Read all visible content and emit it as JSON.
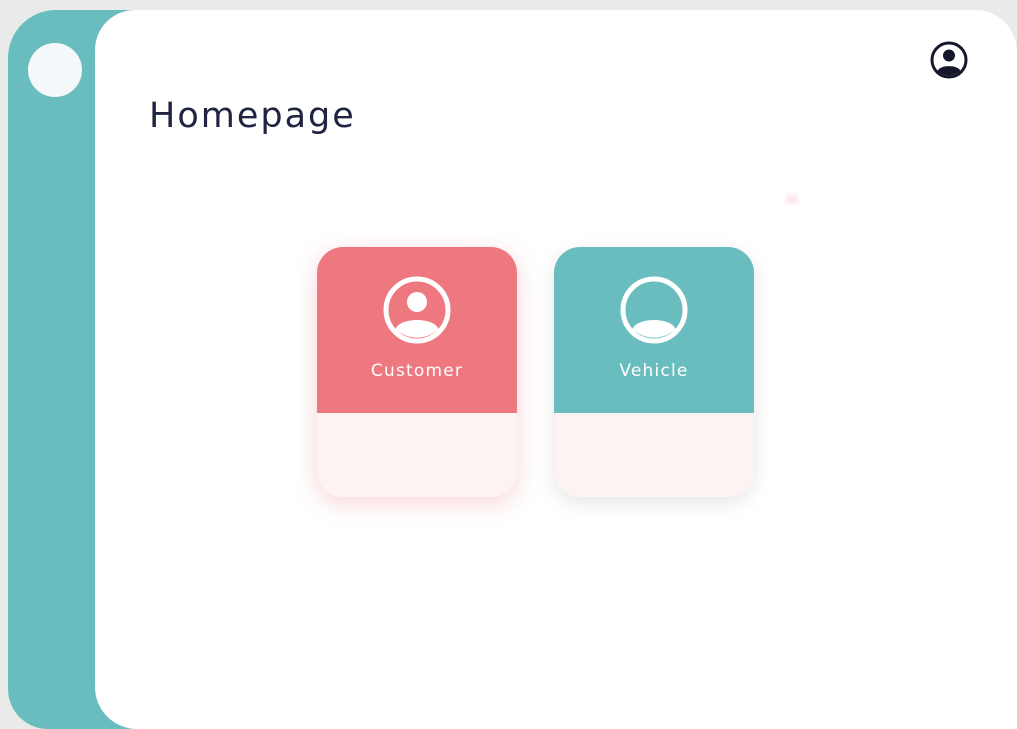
{
  "page": {
    "title": "Homepage"
  },
  "header": {
    "profile_icon": "user-circle-icon"
  },
  "sidebar": {
    "indicator": "sidebar-dot"
  },
  "cards": [
    {
      "label": "Customer",
      "icon": "user-circle-icon",
      "color": "#ee7880"
    },
    {
      "label": "Vehicle",
      "icon": "vehicle-circle-icon",
      "color": "#6abdbe"
    }
  ],
  "colors": {
    "teal": "#6abdbe",
    "coral": "#ee7880",
    "title_text": "#1f2440",
    "card_bottom": "#fdf3f3"
  }
}
